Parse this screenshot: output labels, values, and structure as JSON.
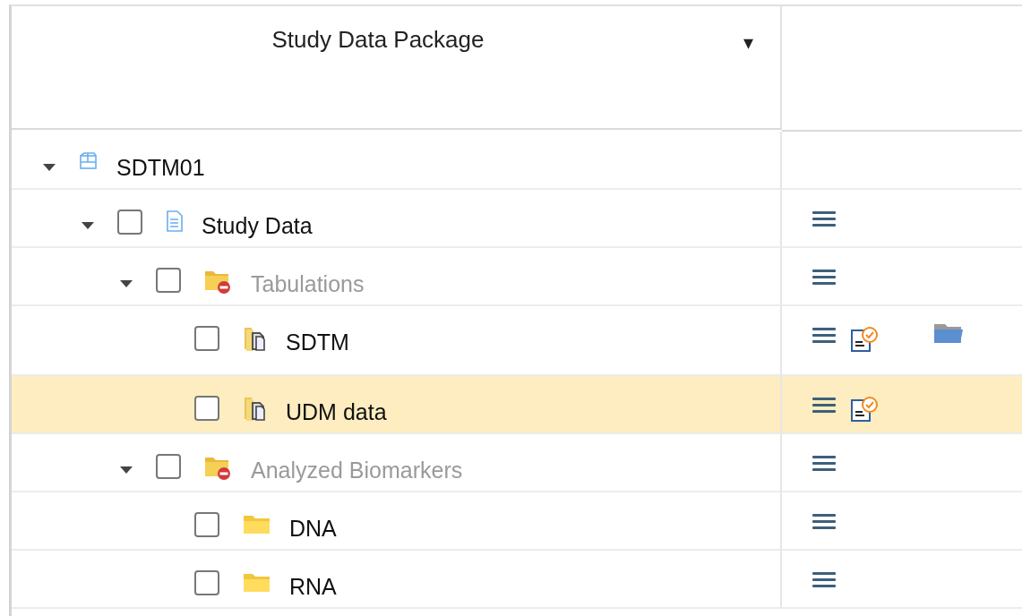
{
  "header": {
    "title": "Study Data Package",
    "caret": "▾"
  },
  "tree": [
    {
      "kind": "package",
      "label": "SDTM01",
      "expanded": true,
      "disabled": false,
      "selected": false,
      "children": [
        {
          "kind": "document",
          "label": "Study Data",
          "checked": false,
          "expanded": true,
          "disabled": false,
          "selected": false,
          "actions": [
            {
              "kind": "menu"
            }
          ],
          "children": [
            {
              "kind": "folder-restricted",
              "label": "Tabulations",
              "checked": false,
              "expanded": true,
              "disabled": true,
              "selected": false,
              "actions": [
                {
                  "kind": "menu"
                }
              ],
              "children": [
                {
                  "kind": "folder-docs",
                  "label": "SDTM",
                  "checked": false,
                  "disabled": false,
                  "selected": false,
                  "actions": [
                    {
                      "kind": "menu"
                    },
                    {
                      "kind": "review"
                    },
                    {
                      "kind": "open-folder"
                    }
                  ]
                },
                {
                  "kind": "folder-docs",
                  "label": "UDM data",
                  "checked": false,
                  "disabled": false,
                  "selected": true,
                  "actions": [
                    {
                      "kind": "menu"
                    },
                    {
                      "kind": "review"
                    }
                  ]
                }
              ]
            },
            {
              "kind": "folder-restricted",
              "label": "Analyzed Biomarkers",
              "checked": false,
              "expanded": true,
              "disabled": true,
              "selected": false,
              "actions": [
                {
                  "kind": "menu"
                }
              ],
              "children": [
                {
                  "kind": "folder",
                  "label": "DNA",
                  "checked": false,
                  "disabled": false,
                  "selected": false,
                  "actions": [
                    {
                      "kind": "menu"
                    }
                  ]
                },
                {
                  "kind": "folder",
                  "label": "RNA",
                  "checked": false,
                  "disabled": false,
                  "selected": false,
                  "actions": [
                    {
                      "kind": "menu"
                    }
                  ]
                }
              ]
            }
          ]
        }
      ]
    }
  ]
}
